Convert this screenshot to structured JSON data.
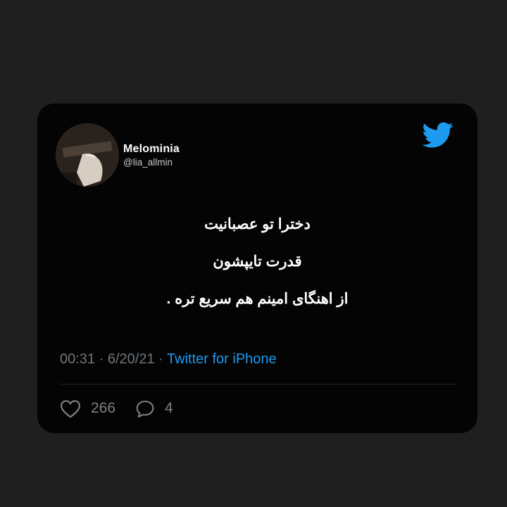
{
  "user": {
    "display_name": "Melominia",
    "handle": "@lia_allmin"
  },
  "tweet": {
    "lines": [
      "دخترا تو عصبانیت",
      "قدرت تایپشون",
      "از اهنگای امینم هم سریع تره ."
    ]
  },
  "meta": {
    "time": "00:31",
    "date": "6/20/21",
    "separator": "·",
    "source": "Twitter for iPhone"
  },
  "stats": {
    "likes": "266",
    "replies": "4"
  },
  "colors": {
    "page_background": "#1f1f1f",
    "card_background": "#040404",
    "twitter_blue": "#1d9bf0",
    "muted_text": "#6f767c"
  },
  "icons": {
    "brand": "twitter-bird-icon",
    "like": "heart-outline-icon",
    "reply": "speech-bubble-icon"
  }
}
